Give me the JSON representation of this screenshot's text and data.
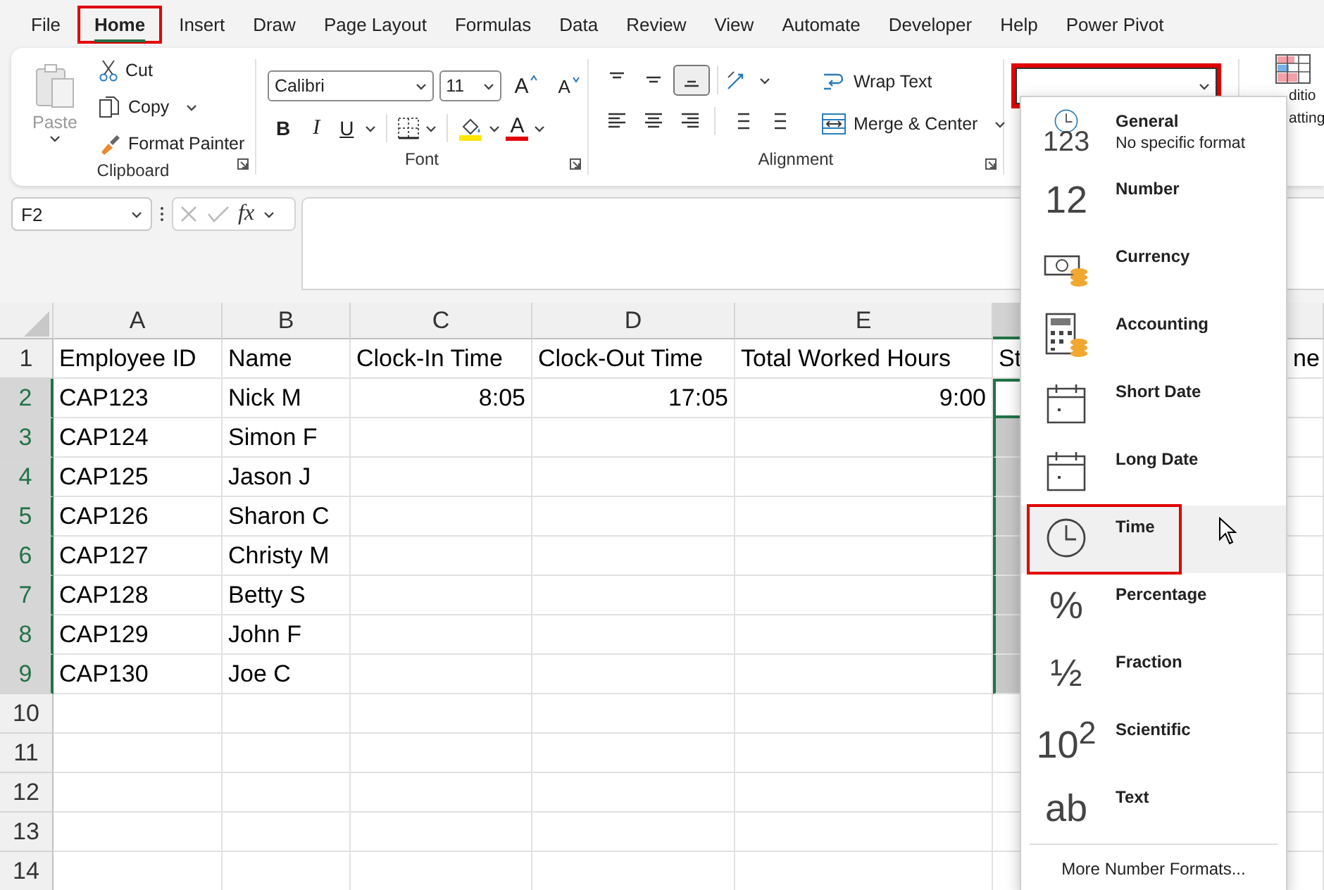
{
  "menu_tabs": [
    {
      "label": "File",
      "selected": false,
      "highlighted": false
    },
    {
      "label": "Home",
      "selected": true,
      "highlighted": true
    },
    {
      "label": "Insert",
      "selected": false,
      "highlighted": false
    },
    {
      "label": "Draw",
      "selected": false,
      "highlighted": false
    },
    {
      "label": "Page Layout",
      "selected": false,
      "highlighted": false
    },
    {
      "label": "Formulas",
      "selected": false,
      "highlighted": false
    },
    {
      "label": "Data",
      "selected": false,
      "highlighted": false
    },
    {
      "label": "Review",
      "selected": false,
      "highlighted": false
    },
    {
      "label": "View",
      "selected": false,
      "highlighted": false
    },
    {
      "label": "Automate",
      "selected": false,
      "highlighted": false
    },
    {
      "label": "Developer",
      "selected": false,
      "highlighted": false
    },
    {
      "label": "Help",
      "selected": false,
      "highlighted": false
    },
    {
      "label": "Power Pivot",
      "selected": false,
      "highlighted": false
    }
  ],
  "ribbon": {
    "clipboard": {
      "paste": {
        "label": "Paste",
        "disabled": true
      },
      "cut": "Cut",
      "copy": "Copy",
      "format_painter": "Format Painter",
      "group_label": "Clipboard"
    },
    "font": {
      "font_name": "Calibri",
      "font_size": "11",
      "grow_glyph": "A",
      "shrink_glyph": "A",
      "bold": "B",
      "italic": "I",
      "underline": "U",
      "font_color": "A",
      "group_label": "Font"
    },
    "alignment": {
      "wrap_text": "Wrap Text",
      "merge_center": "Merge & Center",
      "group_label": "Alignment"
    },
    "number": {
      "highlighted": true
    },
    "conditional_formatting": {
      "label_lines": [
        "ditio",
        "atting"
      ]
    }
  },
  "formula_bar": {
    "name_box": "F2",
    "function_label": "fx"
  },
  "grid": {
    "columns": [
      {
        "label": "A",
        "selected": false
      },
      {
        "label": "B",
        "selected": false
      },
      {
        "label": "C",
        "selected": false
      },
      {
        "label": "D",
        "selected": false
      },
      {
        "label": "E",
        "selected": false
      },
      {
        "selected": true
      }
    ],
    "rows": [
      {
        "number": "1",
        "selected": false,
        "active": false,
        "cells": [
          "Employee ID",
          "Name",
          "Clock-In Time",
          "Clock-Out Time",
          "Total Worked Hours",
          "St",
          "ne"
        ]
      },
      {
        "number": "2",
        "selected": true,
        "active": true,
        "cells": [
          "CAP123",
          "Nick M",
          "8:05",
          "17:05",
          "9:00"
        ]
      },
      {
        "number": "3",
        "selected": true,
        "active": false,
        "cells": [
          "CAP124",
          "Simon F"
        ]
      },
      {
        "number": "4",
        "selected": true,
        "active": false,
        "cells": [
          "CAP125",
          "Jason J"
        ]
      },
      {
        "number": "5",
        "selected": true,
        "active": false,
        "cells": [
          "CAP126",
          "Sharon C"
        ]
      },
      {
        "number": "6",
        "selected": true,
        "active": false,
        "cells": [
          "CAP127",
          "Christy M"
        ]
      },
      {
        "number": "7",
        "selected": true,
        "active": false,
        "cells": [
          "CAP128",
          "Betty S"
        ]
      },
      {
        "number": "8",
        "selected": true,
        "active": false,
        "cells": [
          "CAP129",
          "John F"
        ]
      },
      {
        "number": "9",
        "selected": true,
        "active": false,
        "cells": [
          "CAP130",
          "Joe C"
        ]
      },
      {
        "number": "10",
        "selected": false,
        "active": false
      },
      {
        "number": "11",
        "selected": false,
        "active": false
      },
      {
        "number": "12",
        "selected": false,
        "active": false
      },
      {
        "number": "13",
        "selected": false,
        "active": false
      },
      {
        "number": "14",
        "selected": false,
        "active": false
      }
    ]
  },
  "number_format_menu": {
    "options": [
      {
        "kind": "general",
        "glyph": "123",
        "label": "General",
        "sublabel": "No specific format",
        "selected": false,
        "highlighted": false
      },
      {
        "kind": "number",
        "glyph": "12",
        "label": "Number",
        "selected": false,
        "highlighted": false
      },
      {
        "kind": "currency",
        "label": "Currency",
        "selected": false,
        "highlighted": false
      },
      {
        "kind": "accounting",
        "label": "Accounting",
        "selected": false,
        "highlighted": false
      },
      {
        "kind": "short_date",
        "label": "Short Date",
        "selected": false,
        "highlighted": false
      },
      {
        "kind": "long_date",
        "label": "Long Date",
        "selected": false,
        "highlighted": false
      },
      {
        "kind": "time",
        "label": "Time",
        "selected": true,
        "highlighted": true
      },
      {
        "kind": "percentage",
        "glyph": "%",
        "label": "Percentage",
        "selected": false,
        "highlighted": false
      },
      {
        "kind": "fraction",
        "glyph": "½",
        "label": "Fraction",
        "selected": false,
        "highlighted": false
      },
      {
        "kind": "scientific",
        "glyph": "10$^{2}$",
        "label": "Scientific",
        "selected": false,
        "highlighted": false
      },
      {
        "kind": "text",
        "glyph": "ab",
        "label": "Text",
        "selected": false,
        "highlighted": false
      }
    ],
    "more_link": "More Number Formats..."
  }
}
